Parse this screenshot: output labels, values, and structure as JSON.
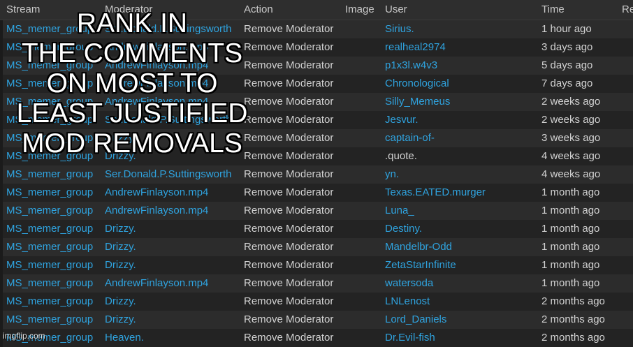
{
  "columns": {
    "stream": "Stream",
    "moderator": "Moderator",
    "action": "Action",
    "image": "Image",
    "user": "User",
    "time": "Time",
    "extra": "Re"
  },
  "rows": [
    {
      "stream": "MS_memer_group",
      "moderator": "Ser.Donald.P.Suttingsworth",
      "action": "Remove Moderator",
      "user": "Sirius.",
      "time": "1 hour ago"
    },
    {
      "stream": "MS_memer_group",
      "moderator": "AndrewFinlayson.mp4",
      "action": "Remove Moderator",
      "user": "realheal2974",
      "time": "3 days ago"
    },
    {
      "stream": "MS_memer_group",
      "moderator": "AndrewFinlayson.mp4",
      "action": "Remove Moderator",
      "user": "p1x3l.w4v3",
      "time": "5 days ago"
    },
    {
      "stream": "MS_memer_group",
      "moderator": "AndrewFinlayson.mp4",
      "action": "Remove Moderator",
      "user": "Chronological",
      "time": "7 days ago"
    },
    {
      "stream": "MS_memer_group",
      "moderator": "AndrewFinlayson.mp4",
      "action": "Remove Moderator",
      "user": "Silly_Memeus",
      "time": "2 weeks ago"
    },
    {
      "stream": "MS_memer_group",
      "moderator": "Ser.Donald.P.Suttingsworth",
      "action": "Remove Moderator",
      "user": "Jesvur.",
      "time": "2 weeks ago"
    },
    {
      "stream": "MS_memer_group",
      "moderator": "Drizzy.",
      "action": "Remove Moderator",
      "user": "captain-of-",
      "time": "3 weeks ago"
    },
    {
      "stream": "MS_memer_group",
      "moderator": "Drizzy.",
      "action": "Remove Moderator",
      "user": ".quote.",
      "time": "4 weeks ago",
      "user_plain": true
    },
    {
      "stream": "MS_memer_group",
      "moderator": "Ser.Donald.P.Suttingsworth",
      "action": "Remove Moderator",
      "user": "yn.",
      "time": "4 weeks ago"
    },
    {
      "stream": "MS_memer_group",
      "moderator": "AndrewFinlayson.mp4",
      "action": "Remove Moderator",
      "user": "Texas.EATED.murger",
      "time": "1 month ago"
    },
    {
      "stream": "MS_memer_group",
      "moderator": "AndrewFinlayson.mp4",
      "action": "Remove Moderator",
      "user": "Luna_",
      "time": "1 month ago"
    },
    {
      "stream": "MS_memer_group",
      "moderator": "Drizzy.",
      "action": "Remove Moderator",
      "user": "Destiny.",
      "time": "1 month ago"
    },
    {
      "stream": "MS_memer_group",
      "moderator": "Drizzy.",
      "action": "Remove Moderator",
      "user": "Mandelbr-Odd",
      "time": "1 month ago"
    },
    {
      "stream": "MS_memer_group",
      "moderator": "Drizzy.",
      "action": "Remove Moderator",
      "user": "ZetaStarInfinite",
      "time": "1 month ago"
    },
    {
      "stream": "MS_memer_group",
      "moderator": "AndrewFinlayson.mp4",
      "action": "Remove Moderator",
      "user": "watersoda",
      "time": "1 month ago"
    },
    {
      "stream": "MS_memer_group",
      "moderator": "Drizzy.",
      "action": "Remove Moderator",
      "user": "LNLenost",
      "time": "2 months ago"
    },
    {
      "stream": "MS_memer_group",
      "moderator": "Drizzy.",
      "action": "Remove Moderator",
      "user": "Lord_Daniels",
      "time": "2 months ago"
    },
    {
      "stream": "MS_memer_group",
      "moderator": "Heaven.",
      "action": "Remove Moderator",
      "user": "Dr.Evil-fish",
      "time": "2 months ago"
    }
  ],
  "overlay": {
    "caption": "RANK IN\nTHE COMMENTS\nON MOST TO\nLEAST JUSTIFIED\nMOD REMOVALS",
    "watermark": "imgflip.com"
  },
  "colors": {
    "link": "#2fa3df",
    "text": "#d2d2d2",
    "header_bg": "#2e2e2e",
    "row_even": "#232323",
    "row_odd": "#2c2c2c"
  }
}
